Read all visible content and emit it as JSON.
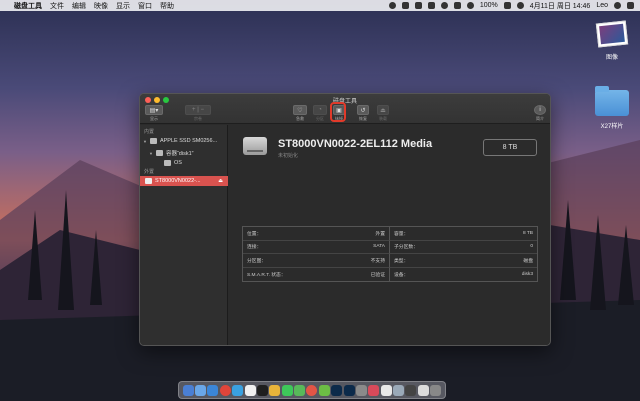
{
  "menubar": {
    "app_name": "磁盘工具",
    "menus": [
      "文件",
      "编辑",
      "映像",
      "显示",
      "窗口",
      "帮助"
    ],
    "battery": "100%",
    "datetime": "4月11日 周日 14:46",
    "user": "Leo"
  },
  "desktop": {
    "items": [
      {
        "label": "图像",
        "icon": "image-file-icon"
      },
      {
        "label": "X27样片",
        "icon": "folder-icon"
      }
    ]
  },
  "window": {
    "title": "磁盘工具",
    "toolbar": {
      "view_label": "显示",
      "volume_label": "宗卷",
      "firstaid_label": "急救",
      "partition_label": "分区",
      "erase_label": "抹掉",
      "restore_label": "恢复",
      "unmount_label": "装载",
      "info_label": "简介"
    },
    "sidebar": {
      "internal_header": "内置",
      "external_header": "外置",
      "items": [
        {
          "label": "APPLE SSD SM0256..."
        },
        {
          "label": "容器“disk1”"
        },
        {
          "label": "OS"
        },
        {
          "label": "ST8000VN0022-..."
        }
      ]
    },
    "device": {
      "name": "ST8000VN0022-2EL112 Media",
      "subtitle": "未初始化",
      "capacity": "8 TB"
    },
    "info": [
      {
        "k": "位置：",
        "v": "外置"
      },
      {
        "k": "容量：",
        "v": "8 TB"
      },
      {
        "k": "连接：",
        "v": "SATA"
      },
      {
        "k": "子分区数：",
        "v": "0"
      },
      {
        "k": "分区图：",
        "v": "不支持"
      },
      {
        "k": "类型：",
        "v": "磁盘"
      },
      {
        "k": "S.M.A.R.T. 状态：",
        "v": "已验证"
      },
      {
        "k": "设备：",
        "v": "disk3"
      }
    ]
  },
  "colors": {
    "selected_sidebar": "#d9534f",
    "highlight_ring": "#e23a2a"
  }
}
